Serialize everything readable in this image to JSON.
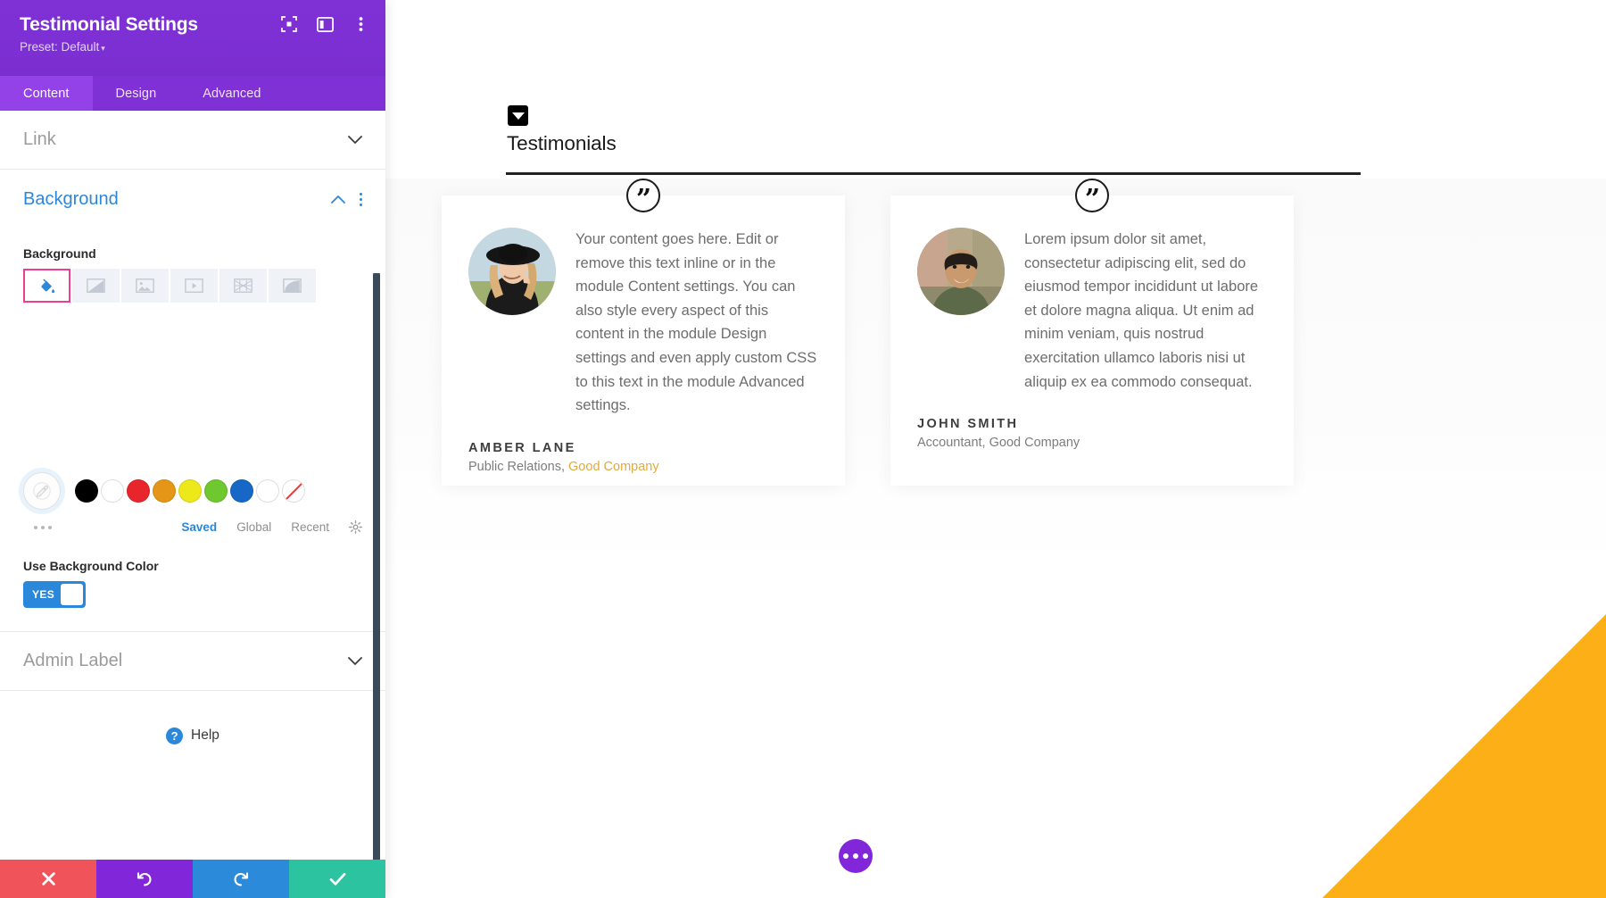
{
  "panel": {
    "title": "Testimonial Settings",
    "preset_label": "Preset: Default",
    "preset_caret": "▾",
    "header_icons": [
      {
        "name": "focus-mode-icon",
        "label": "Focus Mode"
      },
      {
        "name": "panel-layout-icon",
        "label": "Panel Layout"
      },
      {
        "name": "more-options-icon",
        "label": "More Options"
      }
    ],
    "tabs": [
      {
        "label": "Content",
        "active": true
      },
      {
        "label": "Design",
        "active": false
      },
      {
        "label": "Advanced",
        "active": false
      }
    ],
    "sections": {
      "link": {
        "label": "Link",
        "state": "collapsed",
        "chevron": "⌄"
      },
      "background": {
        "label": "Background",
        "state": "expanded",
        "chevron": "⌃"
      },
      "admin_label": {
        "label": "Admin Label",
        "state": "collapsed",
        "chevron": "⌄"
      }
    },
    "background": {
      "field_label": "Background",
      "types": [
        {
          "name": "background-color-icon",
          "label": "Background Color",
          "selected": true
        },
        {
          "name": "background-gradient-icon",
          "label": "Background Gradient",
          "selected": false
        },
        {
          "name": "background-image-icon",
          "label": "Background Image",
          "selected": false
        },
        {
          "name": "background-video-icon",
          "label": "Background Video",
          "selected": false
        },
        {
          "name": "background-pattern-icon",
          "label": "Background Pattern",
          "selected": false
        },
        {
          "name": "background-mask-icon",
          "label": "Background Mask",
          "selected": false
        }
      ],
      "selected_border_color": "#ee3f8e",
      "swatches": [
        {
          "color": "#000000",
          "label": "black"
        },
        {
          "color": "#ffffff",
          "label": "white"
        },
        {
          "color": "#e8252a",
          "label": "red"
        },
        {
          "color": "#e59617",
          "label": "orange"
        },
        {
          "color": "#ece81a",
          "label": "yellow"
        },
        {
          "color": "#6ec82e",
          "label": "green"
        },
        {
          "color": "#1768c6",
          "label": "blue"
        },
        {
          "color": "#ffffff",
          "label": "empty"
        },
        {
          "color": "transparent",
          "label": "none"
        }
      ],
      "palette_tabs": [
        {
          "label": "Saved",
          "active": true
        },
        {
          "label": "Global",
          "active": false
        },
        {
          "label": "Recent",
          "active": false
        }
      ],
      "toggle": {
        "label": "Use Background Color",
        "value": "YES",
        "on": true
      }
    },
    "help": {
      "label": "Help",
      "icon": "?"
    },
    "footer_buttons": [
      {
        "name": "cancel-button",
        "icon": "✕",
        "color": "#f0545a",
        "label": "Cancel"
      },
      {
        "name": "undo-button",
        "icon": "↺",
        "color": "#8126d8",
        "label": "Undo"
      },
      {
        "name": "redo-button",
        "icon": "↻",
        "color": "#2b8ada",
        "label": "Redo"
      },
      {
        "name": "save-button",
        "icon": "✓",
        "color": "#2cc4a0",
        "label": "Save"
      }
    ]
  },
  "page": {
    "section_heading": "Testimonials",
    "cards": [
      {
        "quote": "Your content goes here. Edit or remove this text inline or in the module Content settings. You can also style every aspect of this content in the module Design settings and even apply custom CSS to this text in the module Advanced settings.",
        "author_name": "AMBER LANE",
        "role_prefix": "Public Relations, ",
        "company": "Good Company",
        "company_highlighted": true,
        "avatar": "woman-in-hat-portrait"
      },
      {
        "quote": "Lorem ipsum dolor sit amet, consectetur adipiscing elit, sed do eiusmod tempor incididunt ut labore et dolore magna aliqua. Ut enim ad minim veniam, quis nostrud exercitation ullamco laboris nisi ut aliquip ex ea commodo consequat.",
        "author_name": "JOHN SMITH",
        "role_prefix": "Accountant, ",
        "company": "Good Company",
        "company_highlighted": false,
        "avatar": "smiling-man-portrait"
      }
    ],
    "fab": {
      "name": "page-settings-fab",
      "icon": "ellipsis"
    },
    "accent_triangle_color": "#fcaf17"
  },
  "colors": {
    "brand_purple": "#7b2fd1",
    "tab_active_purple": "#9242e6",
    "accent_blue": "#2b87da",
    "selection_pink": "#ee3f8e",
    "company_gold": "#e0aa3e",
    "triangle_yellow": "#fcaf17"
  }
}
